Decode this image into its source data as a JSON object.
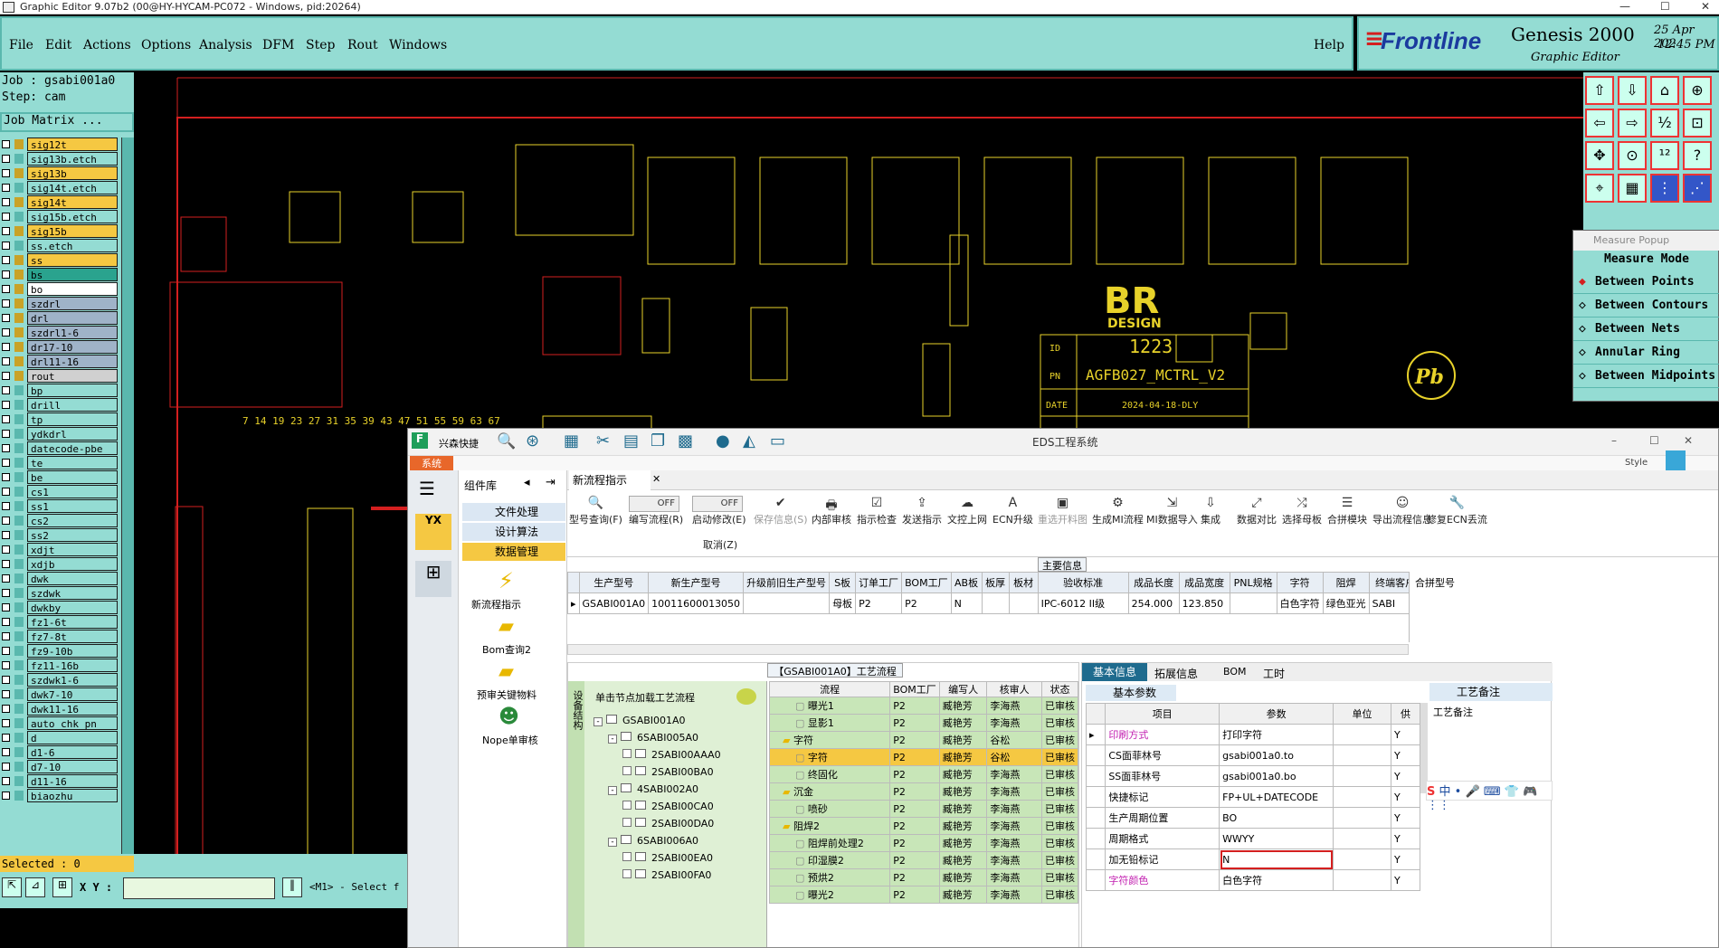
{
  "titlebar": {
    "title": "Graphic Editor 9.07b2 (00@HY-HYCAM-PC072 - Windows, pid:20264)",
    "minimize": "—",
    "maximize": "☐",
    "close": "✕"
  },
  "menu": [
    "File",
    "Edit",
    "Actions",
    "Options",
    "Analysis",
    "DFM",
    "Step",
    "Rout",
    "Windows"
  ],
  "help": "Help",
  "logo": {
    "brand": "Frontline",
    "product": "Genesis 2000",
    "sub": "Graphic Editor",
    "date": "25 Apr 202",
    "time": "12:45 PM"
  },
  "job": {
    "job": "Job : gsabi001a0",
    "step": "Step: cam",
    "matrix": "Job Matrix ..."
  },
  "layers": [
    {
      "n": "sig12t",
      "c": "#f5c842"
    },
    {
      "n": "sig13b.etch",
      "c": "#94dcd3"
    },
    {
      "n": "sig13b",
      "c": "#f5c842"
    },
    {
      "n": "sig14t.etch",
      "c": "#94dcd3"
    },
    {
      "n": "sig14t",
      "c": "#f5c842"
    },
    {
      "n": "sig15b.etch",
      "c": "#94dcd3"
    },
    {
      "n": "sig15b",
      "c": "#f5c842"
    },
    {
      "n": "ss.etch",
      "c": "#94dcd3"
    },
    {
      "n": "ss",
      "c": "#f5c842"
    },
    {
      "n": "bs",
      "c": "#2aa38e"
    },
    {
      "n": "bo",
      "c": "#ffffff"
    },
    {
      "n": "szdrl",
      "c": "#9fb3c8"
    },
    {
      "n": "drl",
      "c": "#9fb3c8"
    },
    {
      "n": "szdrl1-6",
      "c": "#9fb3c8"
    },
    {
      "n": "dr17-10",
      "c": "#9fb3c8"
    },
    {
      "n": "drl11-16",
      "c": "#9fb3c8"
    },
    {
      "n": "rout",
      "c": "#d0d0d0"
    },
    {
      "n": "bp",
      "c": "#94dcd3"
    },
    {
      "n": "drill",
      "c": "#94dcd3"
    },
    {
      "n": "tp",
      "c": "#94dcd3"
    },
    {
      "n": "ydkdrl",
      "c": "#94dcd3"
    },
    {
      "n": "datecode-pbe",
      "c": "#94dcd3"
    },
    {
      "n": "te",
      "c": "#94dcd3"
    },
    {
      "n": "be",
      "c": "#94dcd3"
    },
    {
      "n": "cs1",
      "c": "#94dcd3"
    },
    {
      "n": "ss1",
      "c": "#94dcd3"
    },
    {
      "n": "cs2",
      "c": "#94dcd3"
    },
    {
      "n": "ss2",
      "c": "#94dcd3"
    },
    {
      "n": "xdjt",
      "c": "#94dcd3"
    },
    {
      "n": "xdjb",
      "c": "#94dcd3"
    },
    {
      "n": "dwk",
      "c": "#94dcd3"
    },
    {
      "n": "szdwk",
      "c": "#94dcd3"
    },
    {
      "n": "dwkby",
      "c": "#94dcd3"
    },
    {
      "n": "fz1-6t",
      "c": "#94dcd3"
    },
    {
      "n": "fz7-8t",
      "c": "#94dcd3"
    },
    {
      "n": "fz9-10b",
      "c": "#94dcd3"
    },
    {
      "n": "fz11-16b",
      "c": "#94dcd3"
    },
    {
      "n": "szdwk1-6",
      "c": "#94dcd3"
    },
    {
      "n": "dwk7-10",
      "c": "#94dcd3"
    },
    {
      "n": "dwk11-16",
      "c": "#94dcd3"
    },
    {
      "n": "auto_chk_pn",
      "c": "#94dcd3"
    },
    {
      "n": "d",
      "c": "#94dcd3"
    },
    {
      "n": "d1-6",
      "c": "#94dcd3"
    },
    {
      "n": "d7-10",
      "c": "#94dcd3"
    },
    {
      "n": "d11-16",
      "c": "#94dcd3"
    },
    {
      "n": "biaozhu",
      "c": "#94dcd3"
    }
  ],
  "selected": "Selected : 0",
  "coord": {
    "label": "X Y :",
    "value": "",
    "message": "<M1> - Select f"
  },
  "measure": {
    "title": "Measure Popup",
    "mode": "Measure Mode",
    "items": [
      "Between Points",
      "Between Contours",
      "Between Nets",
      "Annular Ring",
      "Between Midpoints"
    ]
  },
  "board": {
    "id_label": "ID",
    "id": "1223",
    "pn_label": "PN",
    "pn": "AGFB027_MCTRL_V2",
    "date_label": "DATE",
    "date": "2024-04-18-DLY",
    "logo1": "BR",
    "logo2": "DESIGN",
    "pb": "Pb",
    "ruler": "7 14 19 23 27 31 35 39 43 47 51 55 59 63 67"
  },
  "eds": {
    "title": "EDS工程系统",
    "company": "兴森快捷",
    "sys_tab": "系统",
    "style": "Style",
    "lib_title": "组件库",
    "lib_items": [
      "文件处理",
      "设计算法",
      "数据管理"
    ],
    "lib_icons": [
      "新流程指示",
      "Bom查询2",
      "预审关键物料",
      "Nope单审核"
    ],
    "tab": "新流程指示",
    "toolbar": [
      {
        "i": "🔍",
        "l": "型号查询(F)"
      },
      {
        "i": "",
        "l": "编写流程(R)"
      },
      {
        "i": "",
        "l": "启动修改(E)"
      },
      {
        "i": "✔",
        "l": "保存信息(S)"
      },
      {
        "i": "🖶",
        "l": "内部审核"
      },
      {
        "i": "☑",
        "l": "指示检查"
      },
      {
        "i": "⇪",
        "l": "发送指示"
      },
      {
        "i": "☁",
        "l": "文控上网"
      },
      {
        "i": "A",
        "l": "ECN升级"
      },
      {
        "i": "▣",
        "l": "重选开料图"
      },
      {
        "i": "⚙",
        "l": "生成MI流程"
      },
      {
        "i": "⇲",
        "l": "MI数据导入"
      },
      {
        "i": "⇩",
        "l": "集成"
      },
      {
        "i": "⤢",
        "l": "数据对比"
      },
      {
        "i": "⤮",
        "l": "选择母板"
      },
      {
        "i": "☰",
        "l": "合拼模块"
      },
      {
        "i": "☺",
        "l": "导出流程信息"
      },
      {
        "i": "🔧",
        "l": "修复ECN丢流"
      }
    ],
    "toggle_off": "OFF",
    "cancel": "取消(Z)",
    "main_info": "主要信息",
    "grid_headers": [
      "生产型号",
      "新生产型号",
      "升级前旧生产型号",
      "S板",
      "订单工厂",
      "BOM工厂",
      "AB板",
      "板厚",
      "板材",
      "验收标准",
      "成品长度",
      "成品宽度",
      "PNL规格",
      "字符",
      "阻焊",
      "终端客户代码"
    ],
    "grid_row": [
      "GSABI001A0",
      "10011600013050",
      "",
      "母板",
      "P2",
      "P2",
      "N",
      "",
      "",
      "IPC-6012 II级",
      "254.000",
      "123.850",
      "",
      "白色字符",
      "绿色亚光",
      "SABI"
    ],
    "merge_col": "合拼型号",
    "flow_title": "【GSABI001A0】工艺流程",
    "tree_hint": "单击节点加载工艺流程",
    "tree_side": "设备结构",
    "tree": [
      "GSABI001A0",
      "6SABI005A0",
      "2SABI00AAA0",
      "2SABI00BA0",
      "4SABI002A0",
      "2SABI00CA0",
      "2SABI00DA0",
      "6SABI006A0",
      "2SABI00EA0",
      "2SABI00FA0"
    ],
    "flow_headers": [
      "流程",
      "BOM工厂",
      "编写人",
      "核审人",
      "状态"
    ],
    "flow_rows": [
      {
        "n": "曝光1",
        "lv": 2,
        "f": "P2",
        "w": "臧艳芳",
        "r": "李海燕",
        "s": "已审核"
      },
      {
        "n": "显影1",
        "lv": 2,
        "f": "P2",
        "w": "臧艳芳",
        "r": "李海燕",
        "s": "已审核"
      },
      {
        "n": "字符",
        "lv": 1,
        "f": "P2",
        "w": "臧艳芳",
        "r": "谷松",
        "s": "已审核"
      },
      {
        "n": "字符",
        "lv": 2,
        "f": "P2",
        "w": "臧艳芳",
        "r": "谷松",
        "s": "已审核",
        "hl": true
      },
      {
        "n": "终固化",
        "lv": 2,
        "f": "P2",
        "w": "臧艳芳",
        "r": "李海燕",
        "s": "已审核"
      },
      {
        "n": "沉金",
        "lv": 1,
        "f": "P2",
        "w": "臧艳芳",
        "r": "李海燕",
        "s": "已审核"
      },
      {
        "n": "喷砂",
        "lv": 2,
        "f": "P2",
        "w": "臧艳芳",
        "r": "李海燕",
        "s": "已审核"
      },
      {
        "n": "阻焊2",
        "lv": 1,
        "f": "P2",
        "w": "臧艳芳",
        "r": "李海燕",
        "s": "已审核"
      },
      {
        "n": "阻焊前处理2",
        "lv": 2,
        "f": "P2",
        "w": "臧艳芳",
        "r": "李海燕",
        "s": "已审核"
      },
      {
        "n": "印湿膜2",
        "lv": 2,
        "f": "P2",
        "w": "臧艳芳",
        "r": "李海燕",
        "s": "已审核"
      },
      {
        "n": "预烘2",
        "lv": 2,
        "f": "P2",
        "w": "臧艳芳",
        "r": "李海燕",
        "s": "已审核"
      },
      {
        "n": "曝光2",
        "lv": 2,
        "f": "P2",
        "w": "臧艳芳",
        "r": "李海燕",
        "s": "已审核"
      }
    ],
    "info_tabs": [
      "基本信息",
      "拓展信息",
      "BOM",
      "工时"
    ],
    "basic_param": "基本参数",
    "param_headers": [
      "项目",
      "参数",
      "单位",
      "供"
    ],
    "params": [
      {
        "k": "印刷方式",
        "v": "打印字符",
        "u": "",
        "y": "Y",
        "pink": true
      },
      {
        "k": "CS面菲林号",
        "v": "gsabi001a0.to",
        "u": "",
        "y": "Y"
      },
      {
        "k": "SS面菲林号",
        "v": "gsabi001a0.bo",
        "u": "",
        "y": "Y"
      },
      {
        "k": "快捷标记",
        "v": "FP+UL+DATECODE",
        "u": "",
        "y": "Y"
      },
      {
        "k": "生产周期位置",
        "v": "BO",
        "u": "",
        "y": "Y"
      },
      {
        "k": "周期格式",
        "v": "WWYY",
        "u": "",
        "y": "Y"
      },
      {
        "k": "加无铅标记",
        "v": "N",
        "u": "",
        "y": "Y",
        "circle": true
      },
      {
        "k": "字符颜色",
        "v": "白色字符",
        "u": "",
        "y": "Y",
        "pink": true
      }
    ],
    "remark_tab": "工艺备注",
    "remark_label": "工艺备注",
    "ime": [
      "S",
      "中",
      "•",
      "🎤",
      "⌨",
      "👕",
      "🎮",
      "⋮⋮"
    ]
  },
  "colors": {
    "teal": "#94dcd3",
    "trace": "#e8d22a",
    "outline": "#d41f1f",
    "highlight": "#f5c842"
  }
}
